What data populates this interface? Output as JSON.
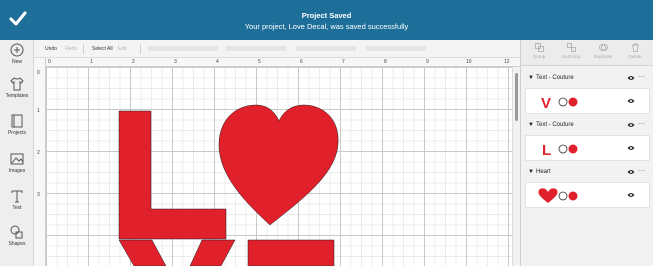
{
  "banner": {
    "title": "Project Saved",
    "message": "Your project, Love Decal, was saved successfully",
    "icon": "checkmark-icon",
    "background": "#1d6f9a"
  },
  "rail": {
    "items": [
      {
        "label": "New",
        "icon": "plus-circle-icon"
      },
      {
        "label": "Templates",
        "icon": "shirt-icon"
      },
      {
        "label": "Projects",
        "icon": "book-icon"
      },
      {
        "label": "Images",
        "icon": "image-icon"
      },
      {
        "label": "Text",
        "icon": "text-icon"
      },
      {
        "label": "Shapes",
        "icon": "shapes-icon"
      }
    ]
  },
  "editbar": {
    "undo": "Undo",
    "redo": "Redo",
    "select_all": "Select All",
    "edit": "Edit"
  },
  "rulers": {
    "top": [
      "0",
      "1",
      "2",
      "3",
      "4",
      "5",
      "6",
      "7",
      "8",
      "9",
      "10",
      "11",
      "12"
    ],
    "left": [
      "0",
      "1",
      "2",
      "3"
    ]
  },
  "canvas": {
    "letter_color": "#e0202a",
    "heart_color": "#e0202a"
  },
  "panel": {
    "tools": [
      {
        "label": "Group",
        "icon": "group-icon"
      },
      {
        "label": "UnGroup",
        "icon": "ungroup-icon"
      },
      {
        "label": "Duplicate",
        "icon": "duplicate-icon"
      },
      {
        "label": "Delete",
        "icon": "trash-icon"
      }
    ],
    "groups": [
      {
        "name": "Text - Couture",
        "layer_letter": "V"
      },
      {
        "name": "Text - Couture",
        "layer_letter": "L"
      },
      {
        "name": "Heart",
        "layer_letter": ""
      }
    ]
  }
}
